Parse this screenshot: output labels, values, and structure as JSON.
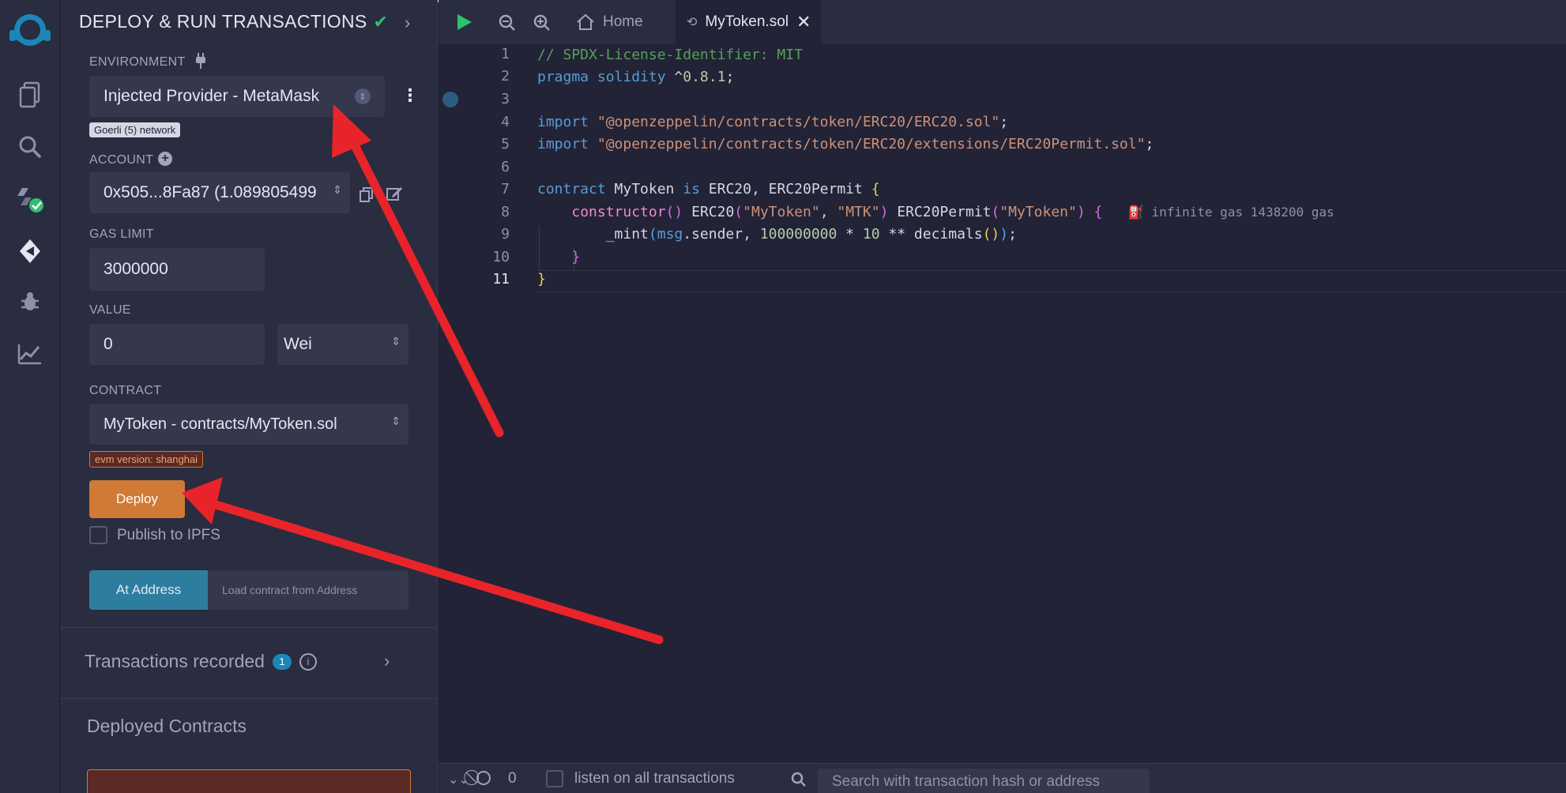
{
  "panel": {
    "title": "DEPLOY & RUN TRANSACTIONS",
    "environment_label": "ENVIRONMENT",
    "environment_value": "Injected Provider - MetaMask",
    "network_badge": "Goerli (5) network",
    "account_label": "ACCOUNT",
    "account_value": "0x505...8Fa87 (1.089805499",
    "gas_limit_label": "GAS LIMIT",
    "gas_limit_value": "3000000",
    "value_label": "VALUE",
    "value_amount": "0",
    "value_unit": "Wei",
    "contract_label": "CONTRACT",
    "contract_value": "MyToken - contracts/MyToken.sol",
    "evm_badge": "evm version: shanghai",
    "deploy_label": "Deploy",
    "publish_label": "Publish to IPFS",
    "at_address_label": "At Address",
    "load_placeholder": "Load contract from Address",
    "transactions_label": "Transactions recorded",
    "transactions_count": "1",
    "deployed_label": "Deployed Contracts"
  },
  "tabs": {
    "home": "Home",
    "file": "MyToken.sol"
  },
  "editor": {
    "line_numbers": [
      "1",
      "2",
      "3",
      "4",
      "5",
      "6",
      "7",
      "8",
      "9",
      "10",
      "11"
    ],
    "gas_hint": "infinite gas 1438200 gas"
  },
  "terminal": {
    "count": "0",
    "listen_label": "listen on all transactions",
    "search_placeholder": "Search with transaction hash or address"
  },
  "colors": {
    "accent_deploy": "#d07a35",
    "accent_at_address": "#2d7e9e",
    "annotation_arrow": "#e8242a",
    "success_check": "#2fbf71"
  }
}
